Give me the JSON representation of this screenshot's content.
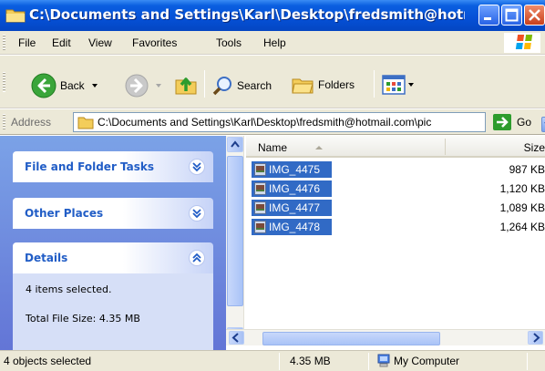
{
  "window": {
    "title": "C:\\Documents and Settings\\Karl\\Desktop\\fredsmith@hotmail...",
    "buttons": {
      "minimize": "minimize",
      "maximize": "maximize",
      "close": "close"
    }
  },
  "menu": [
    "File",
    "Edit",
    "View",
    "Favorites",
    "Tools",
    "Help"
  ],
  "toolbar": {
    "back": "Back",
    "search": "Search",
    "folders": "Folders"
  },
  "address": {
    "label": "Address",
    "value": "C:\\Documents and Settings\\Karl\\Desktop\\fredsmith@hotmail.com\\pic",
    "go": "Go"
  },
  "task_pane": {
    "file_tasks": "File and Folder Tasks",
    "other_places": "Other Places",
    "details": {
      "title": "Details",
      "line1": "4 items selected.",
      "line2": "Total File Size: 4.35 MB"
    }
  },
  "file_list": {
    "columns": {
      "name": "Name",
      "size": "Size"
    },
    "rows": [
      {
        "name": "IMG_4475",
        "size": "987 KB"
      },
      {
        "name": "IMG_4476",
        "size": "1,120 KB"
      },
      {
        "name": "IMG_4477",
        "size": "1,089 KB"
      },
      {
        "name": "IMG_4478",
        "size": "1,264 KB"
      }
    ]
  },
  "status": {
    "objects": "4 objects selected",
    "size": "4.35 MB",
    "location": "My Computer"
  },
  "colors": {
    "titlebar": "#0550d6",
    "selection": "#316ac5",
    "task_link": "#215dc6"
  }
}
